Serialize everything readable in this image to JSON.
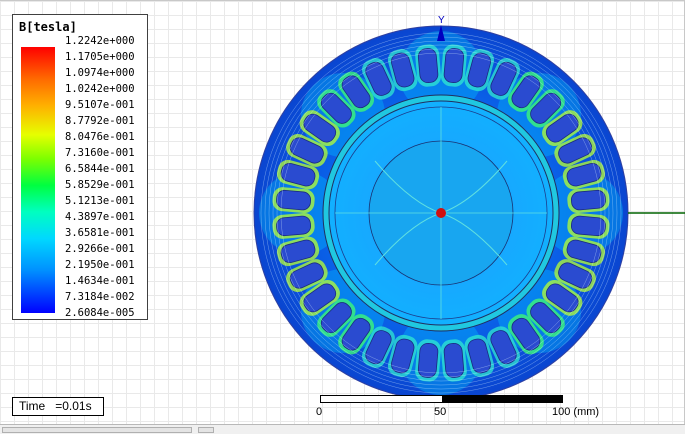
{
  "legend": {
    "title": "B[tesla]",
    "values": [
      "1.2242e+000",
      "1.1705e+000",
      "1.0974e+000",
      "1.0242e+000",
      "9.5107e-001",
      "8.7792e-001",
      "8.0476e-001",
      "7.3160e-001",
      "6.5844e-001",
      "5.8529e-001",
      "5.1213e-001",
      "4.3897e-001",
      "3.6581e-001",
      "2.9266e-001",
      "2.1950e-001",
      "1.4634e-001",
      "7.3184e-002",
      "2.6084e-005"
    ],
    "colors": [
      "#ff0000",
      "#0000ff"
    ]
  },
  "axis": {
    "y_label": "Y"
  },
  "time": {
    "text": "Time   =0.01s"
  },
  "scale": {
    "labels": [
      "0",
      "50",
      "100 (mm)"
    ]
  },
  "icons": {
    "axis_arrow": "y-axis-arrow-icon",
    "origin": "origin-marker-icon"
  },
  "stator": {
    "slots": 36
  },
  "colors": {
    "field_low": "#0a4fd8",
    "field_mid": "#00d8ff",
    "field_high": "#3cff3c",
    "conductor": "#2a4bd0",
    "x_axis": "#006400"
  }
}
